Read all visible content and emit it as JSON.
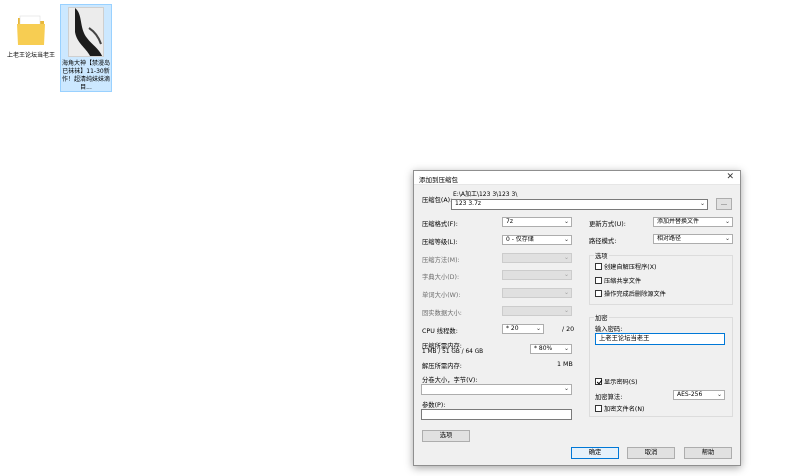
{
  "desktop": {
    "icons": [
      {
        "label": "上老王论坛当老王",
        "type": "folder"
      },
      {
        "label": "海角大神【禁漫岛已袜袜】11-30新作！超清纯妹妹滴目...",
        "type": "image"
      }
    ]
  },
  "dialog": {
    "title": "添加到压缩包",
    "close_glyph": "✕",
    "archive": {
      "label": "压缩包(A):",
      "path": "E:\\A加工\\123 3\\123 3\\",
      "name_value": "123 3.7z",
      "browse_label": "..."
    },
    "left": {
      "format": {
        "label": "压缩格式(F):",
        "value": "7z"
      },
      "level": {
        "label": "压缩等级(L):",
        "value": "0 - 仅存储"
      },
      "method": {
        "label": "压缩方法(M):",
        "value": ""
      },
      "dict": {
        "label": "字典大小(D):",
        "value": ""
      },
      "word": {
        "label": "单词大小(W):",
        "value": ""
      },
      "solid": {
        "label": "固实数据大小:",
        "value": ""
      },
      "cpu": {
        "label": "CPU 线程数:",
        "value": "* 20",
        "total": "/ 20"
      },
      "memory": {
        "label": "压缩所需内存:",
        "detail": "1 MB / 51 GB / 64 GB",
        "value": "* 80%"
      },
      "decompress_mem": {
        "label": "解压所需内存:",
        "value": "1 MB"
      },
      "split": {
        "label": "分卷大小，字节(V):",
        "value": ""
      },
      "params": {
        "label": "参数(P):",
        "value": ""
      },
      "options_button": "选项"
    },
    "right": {
      "update": {
        "label": "更新方式(U):",
        "value": "添加并替换文件"
      },
      "path_mode": {
        "label": "路径模式:",
        "value": "相对路径"
      },
      "options_group": {
        "title": "选项",
        "items": [
          {
            "label": "创建自解压程序(X)",
            "checked": false
          },
          {
            "label": "压缩共享文件",
            "checked": false
          },
          {
            "label": "操作完成后删除源文件",
            "checked": false
          }
        ]
      },
      "encryption_group": {
        "title": "加密",
        "password_label": "输入密码:",
        "password_value": "上老王论坛当老王",
        "show_password": {
          "label": "显示密码(S)",
          "checked": true
        },
        "method_label": "加密算法:",
        "method_value": "AES-256",
        "encrypt_names": {
          "label": "加密文件名(N)",
          "checked": false
        }
      }
    },
    "buttons": {
      "ok": "确定",
      "cancel": "取消",
      "help": "帮助"
    }
  }
}
